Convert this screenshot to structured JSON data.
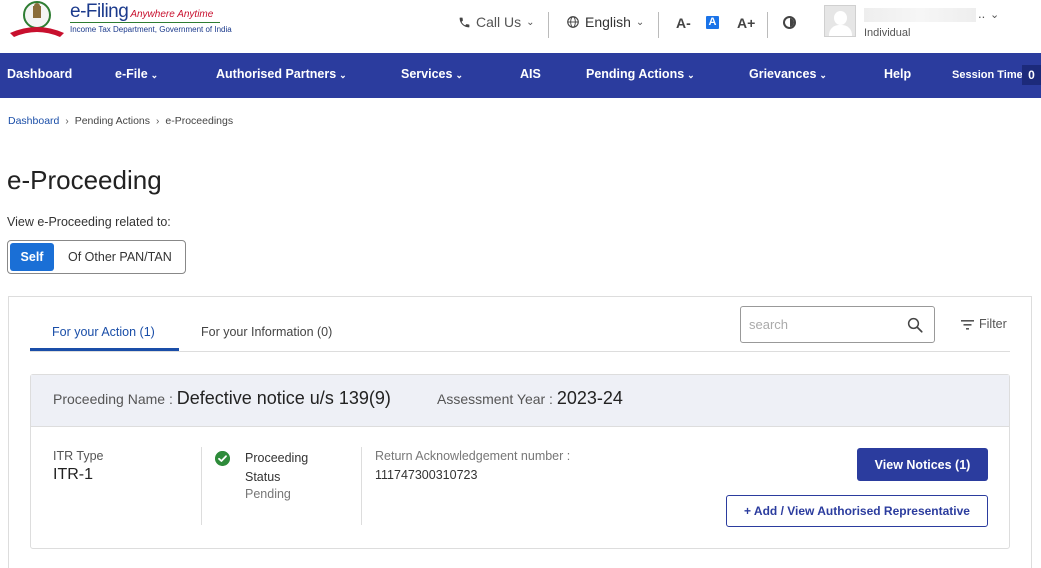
{
  "header": {
    "logo_title": "e-Filing",
    "logo_tagline": "Anywhere Anytime",
    "logo_subtitle": "Income Tax Department, Government of India",
    "call_us": "Call Us",
    "language": "English",
    "font_decrease": "A-",
    "font_normal": "A",
    "font_increase": "A+",
    "user_ellipsis": "..",
    "user_role": "Individual"
  },
  "nav": {
    "items": [
      {
        "label": "Dashboard"
      },
      {
        "label": "e-File"
      },
      {
        "label": "Authorised Partners"
      },
      {
        "label": "Services"
      },
      {
        "label": "AIS"
      },
      {
        "label": "Pending Actions"
      },
      {
        "label": "Grievances"
      },
      {
        "label": "Help"
      }
    ],
    "session_label": "Session Time",
    "session_value": "0"
  },
  "breadcrumb": {
    "items": [
      "Dashboard",
      "Pending Actions",
      "e-Proceedings"
    ]
  },
  "page": {
    "title": "e-Proceeding",
    "view_label": "View e-Proceeding related to:",
    "toggle_self": "Self",
    "toggle_other": "Of Other PAN/TAN"
  },
  "tabs": {
    "action": "For your Action (1)",
    "information": "For your Information (0)"
  },
  "search": {
    "placeholder": "search"
  },
  "filter_label": "Filter",
  "proceeding": {
    "name_label": "Proceeding Name :",
    "name_value": "Defective notice u/s 139(9)",
    "ay_label": "Assessment Year :",
    "ay_value": "2023-24",
    "itr_type_label": "ITR Type",
    "itr_type_value": "ITR-1",
    "status_label_line1": "Proceeding",
    "status_label_line2": "Status",
    "status_value": "Pending",
    "ack_label": "Return Acknowledgement number :",
    "ack_value": "111747300310723",
    "view_notices_button": "View Notices (1)",
    "authorised_rep_button": "+ Add / View Authorised Representative"
  },
  "colors": {
    "nav_bg": "#2b3c9e",
    "primary_button": "#2b3c9e",
    "toggle_active": "#1a6fd6",
    "status_check": "#2e8b3a"
  }
}
